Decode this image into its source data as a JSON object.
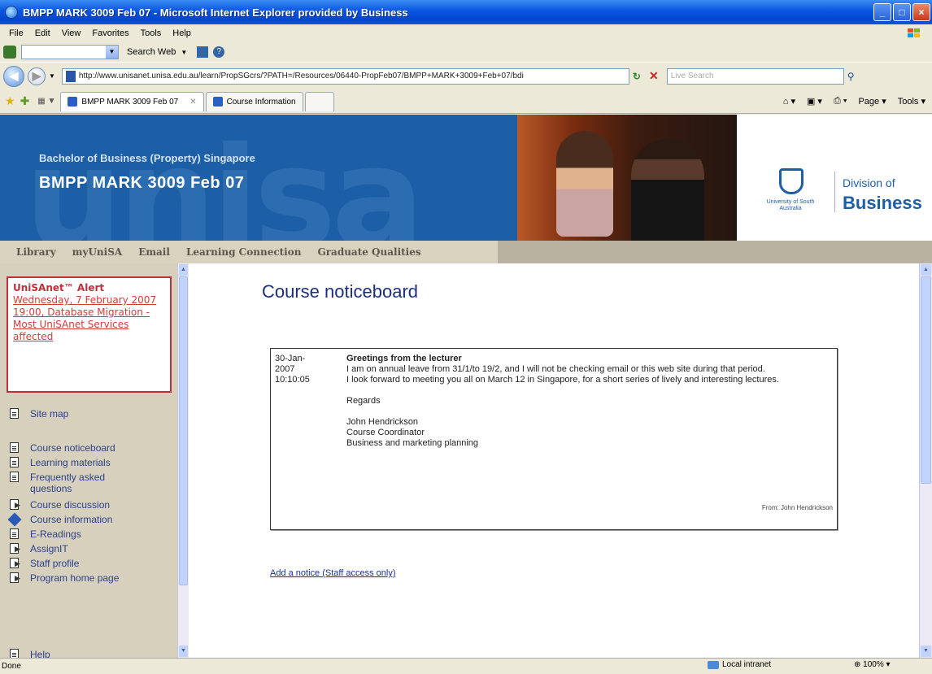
{
  "window": {
    "title": "BMPP MARK 3009 Feb 07 - Microsoft Internet Explorer provided by Business"
  },
  "menu": [
    "File",
    "Edit",
    "View",
    "Favorites",
    "Tools",
    "Help"
  ],
  "toolbar": {
    "search_label": "Search Web"
  },
  "address": {
    "url": "http://www.unisanet.unisa.edu.au/learn/PropSGcrs/?PATH=/Resources/06440-PropFeb07/BMPP+MARK+3009+Feb+07/bdi",
    "search_placeholder": "Live Search"
  },
  "tabs": [
    {
      "label": "BMPP MARK 3009 Feb 07"
    },
    {
      "label": "Course Information"
    }
  ],
  "command_bar": {
    "page": "Page",
    "tools": "Tools"
  },
  "banner": {
    "subtitle": "Bachelor of Business (Property) Singapore",
    "course_title": "BMPP MARK 3009 Feb 07",
    "watermark": "unisa",
    "unisa_text": "University of South Australia",
    "division_of": "Division of",
    "division_name": "Business"
  },
  "nav": [
    "Library",
    "myUniSA",
    "Email",
    "Learning Connection",
    "Graduate Qualities"
  ],
  "sidebar": {
    "alert_title": "UniSAnet™ Alert",
    "alert_link": "Wednesday, 7 February 2007 19:00, Database Migration - Most UniSAnet Services affected",
    "links": [
      {
        "label": "Site map",
        "icon": "document-icon"
      },
      {
        "label": "Course noticeboard",
        "icon": "document-icon"
      },
      {
        "label": "Learning materials",
        "icon": "document-icon"
      },
      {
        "label": "Frequently asked questions",
        "icon": "document-icon"
      },
      {
        "label": "Course discussion",
        "icon": "arrow-icon"
      },
      {
        "label": "Course information",
        "icon": "diamond-icon"
      },
      {
        "label": "E-Readings",
        "icon": "document-icon"
      },
      {
        "label": "AssignIT",
        "icon": "arrow-icon"
      },
      {
        "label": "Staff profile",
        "icon": "arrow-icon"
      },
      {
        "label": "Program home page",
        "icon": "arrow-icon"
      },
      {
        "label": "Help",
        "icon": "document-icon"
      }
    ]
  },
  "main": {
    "title": "Course noticeboard",
    "notice": {
      "date_line1": "30-Jan-",
      "date_line2": "2007",
      "time": "10:10:05",
      "heading": "Greetings from the lecturer",
      "para1": "I am on annual leave from 31/1/to 19/2, and I will not be checking email or this web site during that period.",
      "para2": "I look forward to meeting you all on March 12 in Singapore, for a short series of lively and interesting lectures.",
      "regards": "Regards",
      "sig_name": "John Hendrickson",
      "sig_role": "Course Coordinator",
      "sig_course": "Business and marketing planning",
      "from": "From: John Hendrickson"
    },
    "add_notice": "Add a notice (Staff access only)"
  },
  "status": {
    "text": "Done",
    "zone": "Local intranet",
    "zoom": "100%"
  }
}
